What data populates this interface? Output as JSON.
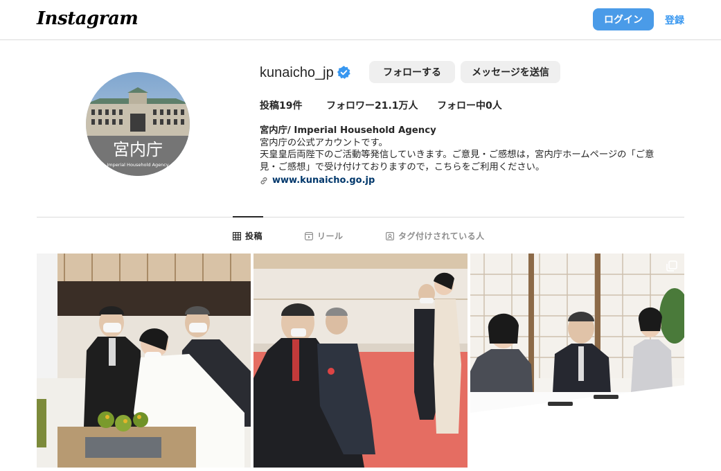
{
  "header": {
    "logo": "Instagram",
    "login_label": "ログイン",
    "signup_label": "登録"
  },
  "profile": {
    "username": "kunaicho_jp",
    "follow_label": "フォローする",
    "message_label": "メッセージを送信",
    "stats": {
      "posts": "投稿19件",
      "followers": "フォロワー21.1万人",
      "following": "フォロー中0人"
    },
    "bio": {
      "name": "宮内庁/ Imperial Household Agency",
      "lines": [
        "宮内庁の公式アカウントです。",
        "天皇皇后両陛下のご活動等発信していきます。ご意見・ご感想は，宮内庁ホームページの「ご意",
        "見・ご感想」で受け付けておりますので，こちらをご利用ください。"
      ],
      "link": "www.kunaicho.go.jp"
    },
    "avatar": {
      "title": "宮内庁",
      "subtitle": "Imperial Household Agency"
    }
  },
  "tabs": [
    {
      "label": "投稿",
      "icon": "grid-icon",
      "active": true
    },
    {
      "label": "リール",
      "icon": "reels-icon",
      "active": false
    },
    {
      "label": "タグ付けされている人",
      "icon": "tagged-icon",
      "active": false
    }
  ],
  "colors": {
    "primary_blue": "#4a9be8",
    "link_blue": "#00376b",
    "verified_blue": "#3897f0"
  }
}
